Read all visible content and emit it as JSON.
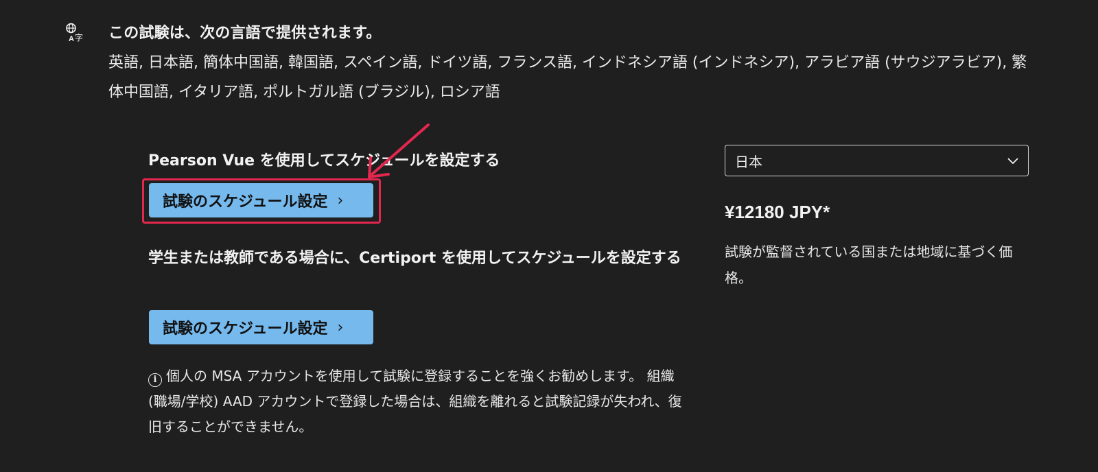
{
  "languages": {
    "icon": "language-translate-icon",
    "title": "この試験は、次の言語で提供されます。",
    "list": "英語, 日本語, 簡体中国語, 韓国語, スペイン語, ドイツ語, フランス語, インドネシア語 (インドネシア), アラビア語 (サウジアラビア), 繁体中国語, イタリア語, ポルトガル語 (ブラジル), ロシア語"
  },
  "pearson": {
    "heading": "Pearson Vue を使用してスケジュールを設定する",
    "button_label": "試験のスケジュール設定",
    "button_chevron": "›"
  },
  "certiport": {
    "heading": "学生または教師である場合に、Certiport を使用してスケジュールを設定する",
    "button_label": "試験のスケジュール設定",
    "button_chevron": "›"
  },
  "info": {
    "icon_glyph": "i",
    "text": "個人の MSA アカウントを使用して試験に登録することを強くお勧めします。 組織 (職場/学校) AAD アカウントで登録した場合は、組織を離れると試験記録が失われ、復旧することができません。"
  },
  "pricing": {
    "country_selected": "日本",
    "price": "¥12180 JPY*",
    "note": "試験が監督されている国または地域に基づく価格。"
  },
  "colors": {
    "background": "#1f1f1f",
    "button": "#76b9ed",
    "annotation": "#e5274f"
  }
}
